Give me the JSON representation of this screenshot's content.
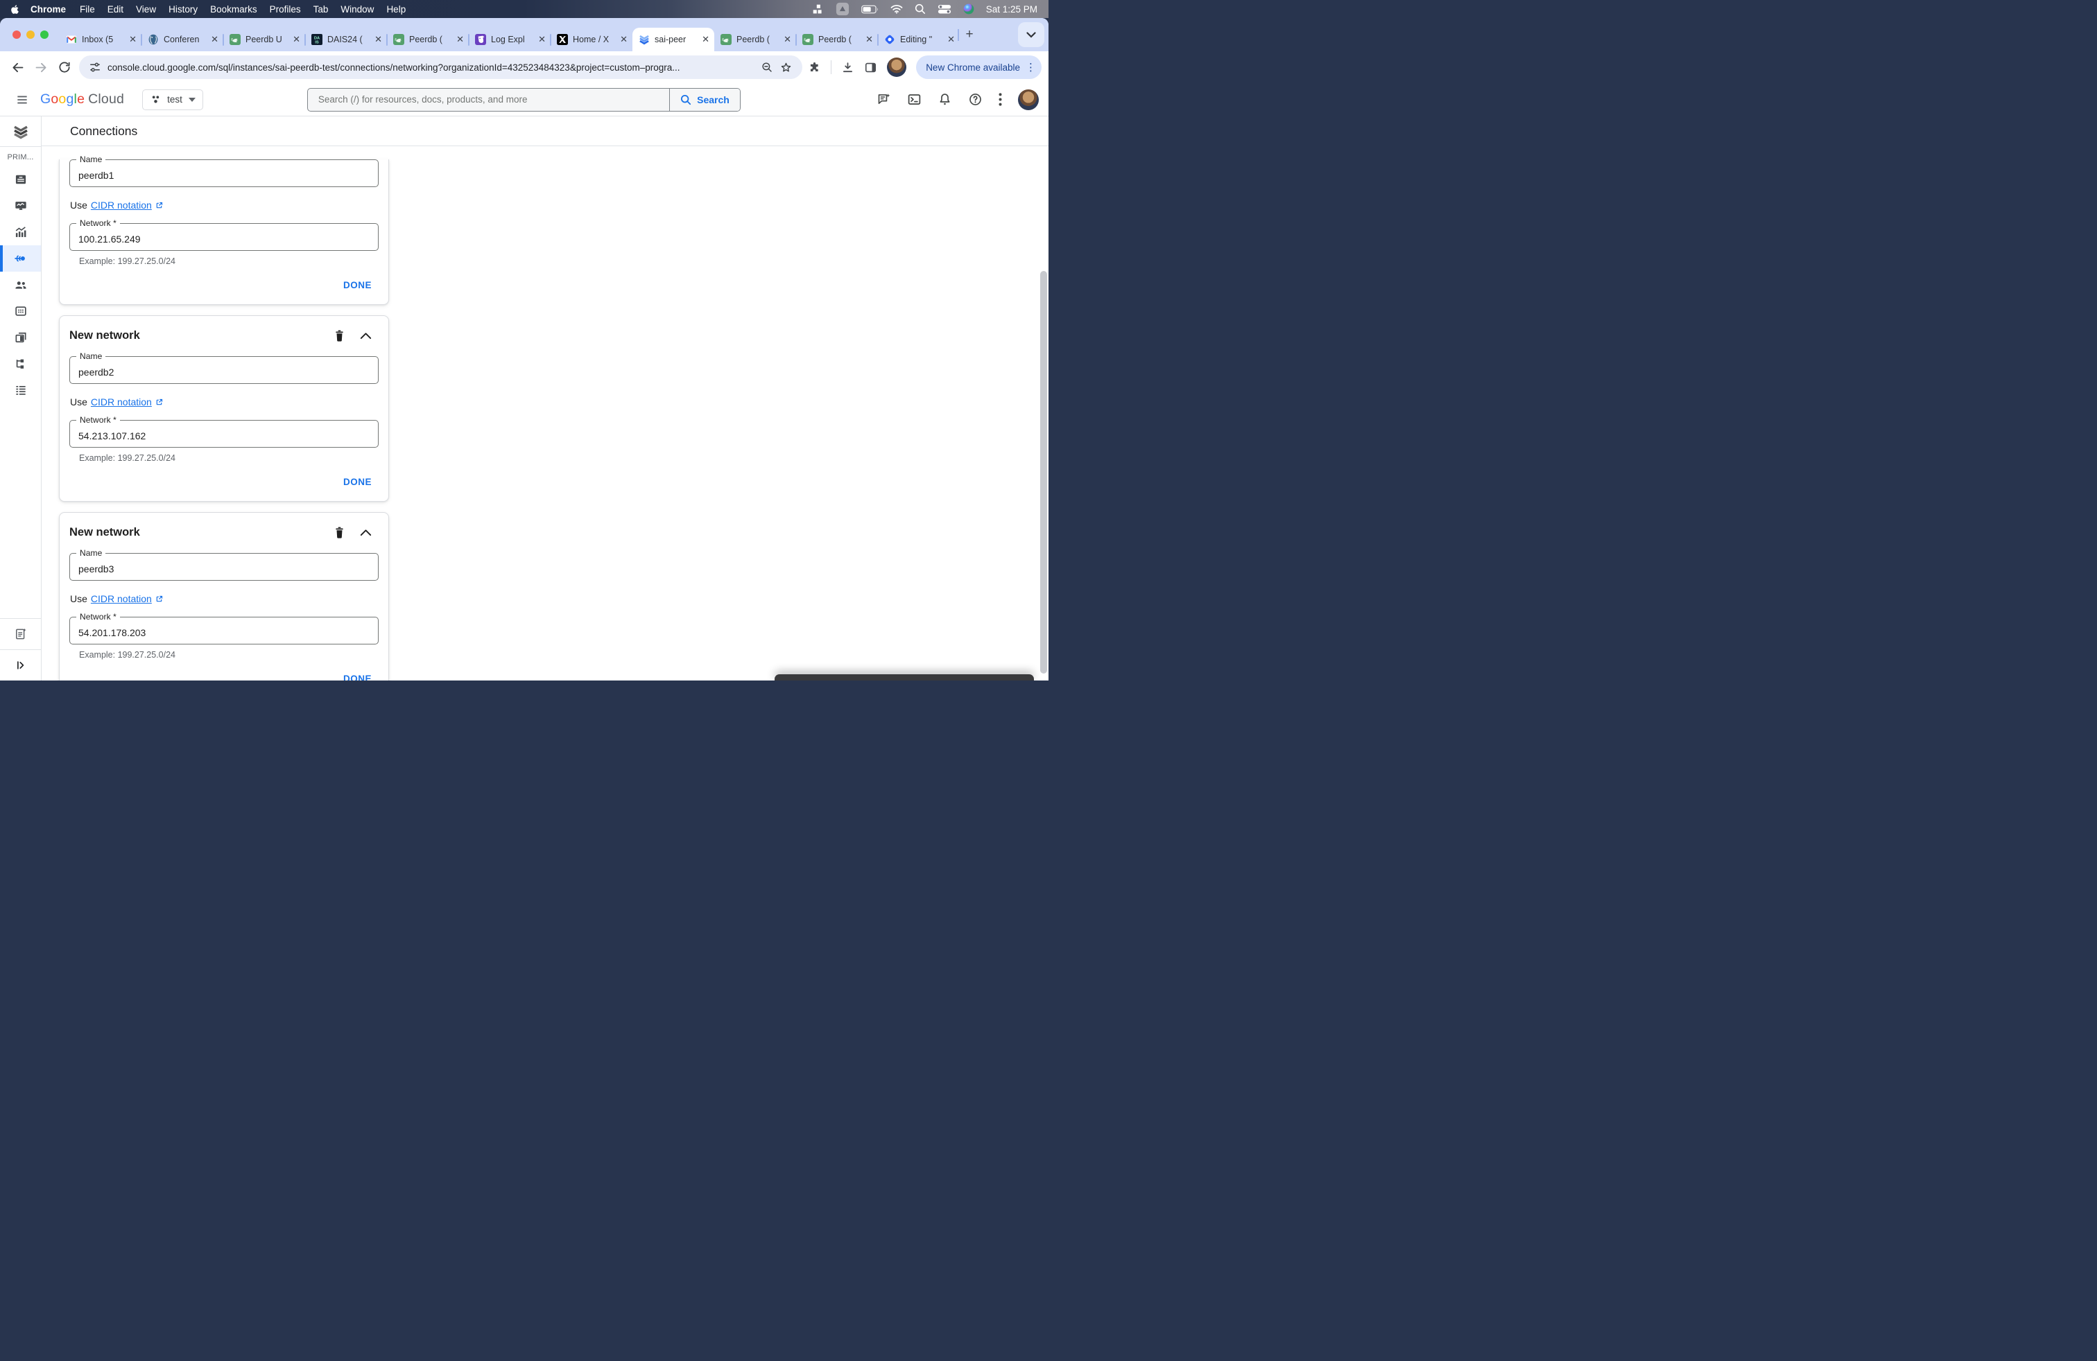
{
  "menubar": {
    "items": [
      "Chrome",
      "File",
      "Edit",
      "View",
      "History",
      "Bookmarks",
      "Profiles",
      "Tab",
      "Window",
      "Help"
    ],
    "clock": "Sat 1:25 PM",
    "status_icons": [
      "grid-blocks-icon",
      "app-window-icon",
      "battery-icon",
      "wifi-icon",
      "search-icon",
      "control-center-icon",
      "siri-icon"
    ]
  },
  "tabstrip": {
    "close_glyph": "✕",
    "new_tab_label": "+",
    "tabs": [
      {
        "icon": "gmail-icon",
        "label": "Inbox (5"
      },
      {
        "icon": "postgres-icon",
        "label": "Conferen"
      },
      {
        "icon": "peerdb-icon",
        "label": "Peerdb U"
      },
      {
        "icon": "dais-icon",
        "label": "DAIS24 (",
        "icon_text_top": "DA",
        "icon_text_bottom": "IS"
      },
      {
        "icon": "peerdb-icon",
        "label": "Peerdb ("
      },
      {
        "icon": "datadog-icon",
        "label": "Log Expl"
      },
      {
        "icon": "x-icon",
        "label": "Home / X"
      },
      {
        "icon": "cloud-sql-icon",
        "label": "sai-peer",
        "active": true
      },
      {
        "icon": "peerdb-icon",
        "label": "Peerdb ("
      },
      {
        "icon": "peerdb-icon",
        "label": "Peerdb ("
      },
      {
        "icon": "editing-app-icon",
        "label": "Editing \""
      }
    ]
  },
  "urlbar": {
    "url": "console.cloud.google.com/sql/instances/sai-peerdb-test/connections/networking?organizationId=432523484323&project=custom–progra...",
    "update_button": "New Chrome available",
    "menu_glyph": "⋮"
  },
  "gcloud": {
    "logo_letters": [
      "G",
      "o",
      "o",
      "g",
      "l",
      "e"
    ],
    "logo_cloud": "Cloud",
    "project": "test",
    "search_placeholder": "Search (/) for resources, docs, products, and more",
    "search_button": "Search"
  },
  "sidebar": {
    "section": "PRIM...",
    "items": [
      "overview",
      "monitoring",
      "system-insights",
      "connections",
      "users",
      "databases",
      "backups",
      "replication",
      "operations"
    ],
    "active_item": "connections"
  },
  "page": {
    "title": "Connections"
  },
  "cards": [
    {
      "name_label": "Name",
      "name_value": "peerdb1",
      "use_prefix": "Use",
      "cidr_link": "CIDR notation",
      "network_label": "Network *",
      "network_value": "100.21.65.249",
      "example": "Example: 199.27.25.0/24",
      "done": "DONE"
    },
    {
      "header": "New network",
      "name_label": "Name",
      "name_value": "peerdb2",
      "use_prefix": "Use",
      "cidr_link": "CIDR notation",
      "network_label": "Network *",
      "network_value": "54.213.107.162",
      "example": "Example: 199.27.25.0/24",
      "done": "DONE"
    },
    {
      "header": "New network",
      "name_label": "Name",
      "name_value": "peerdb3",
      "use_prefix": "Use",
      "cidr_link": "CIDR notation",
      "network_label": "Network *",
      "network_value": "54.201.178.203",
      "example": "Example: 199.27.25.0/24",
      "done": "DONE"
    }
  ],
  "colors": {
    "accent_blue": "#1a73e8",
    "tabstrip_bg": "#cdd9f7",
    "active_sidebar_bg": "#e8f0fe",
    "link_blue": "#1a73e8",
    "update_pill_bg": "#d8e3fc",
    "update_pill_text": "#18418f"
  }
}
